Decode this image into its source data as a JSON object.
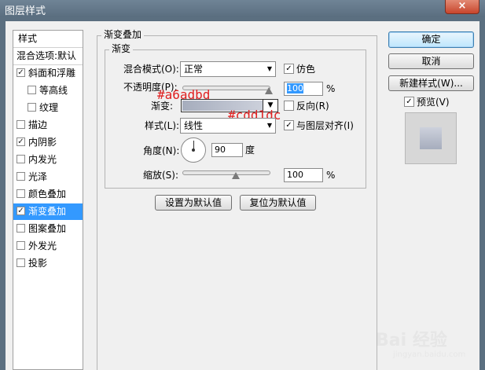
{
  "window": {
    "title": "图层样式",
    "close_label": "×"
  },
  "styles": {
    "header": "样式",
    "blend_options": "混合选项:默认",
    "items": [
      {
        "label": "斜面和浮雕",
        "checked": true,
        "indent": false,
        "selected": false
      },
      {
        "label": "等高线",
        "checked": false,
        "indent": true,
        "selected": false
      },
      {
        "label": "纹理",
        "checked": false,
        "indent": true,
        "selected": false
      },
      {
        "label": "描边",
        "checked": false,
        "indent": false,
        "selected": false
      },
      {
        "label": "内阴影",
        "checked": true,
        "indent": false,
        "selected": false
      },
      {
        "label": "内发光",
        "checked": false,
        "indent": false,
        "selected": false
      },
      {
        "label": "光泽",
        "checked": false,
        "indent": false,
        "selected": false
      },
      {
        "label": "颜色叠加",
        "checked": false,
        "indent": false,
        "selected": false
      },
      {
        "label": "渐变叠加",
        "checked": true,
        "indent": false,
        "selected": true
      },
      {
        "label": "图案叠加",
        "checked": false,
        "indent": false,
        "selected": false
      },
      {
        "label": "外发光",
        "checked": false,
        "indent": false,
        "selected": false
      },
      {
        "label": "投影",
        "checked": false,
        "indent": false,
        "selected": false
      }
    ]
  },
  "panel": {
    "section_title": "渐变叠加",
    "group_title": "渐变",
    "blend_mode_label": "混合模式(O):",
    "blend_mode_value": "正常",
    "dither_label": "仿色",
    "dither_checked": true,
    "opacity_label": "不透明度(P):",
    "opacity_value": "100",
    "opacity_unit": "%",
    "gradient_label": "渐变:",
    "reverse_label": "反向(R)",
    "reverse_checked": false,
    "style_label": "样式(L):",
    "style_value": "线性",
    "align_label": "与图层对齐(I)",
    "align_checked": true,
    "angle_label": "角度(N):",
    "angle_value": "90",
    "angle_unit": "度",
    "scale_label": "缩放(S):",
    "scale_value": "100",
    "scale_unit": "%",
    "set_default_label": "设置为默认值",
    "reset_default_label": "复位为默认值"
  },
  "annotations": {
    "color1": "#a6adbd",
    "color2": "#cdd1dc"
  },
  "gradient_colors": {
    "start": "#a6adbd",
    "end": "#cdd1dc"
  },
  "buttons": {
    "ok": "确定",
    "cancel": "取消",
    "new_style": "新建样式(W)...",
    "preview_label": "预览(V)",
    "preview_checked": true
  },
  "watermark": {
    "text": "Bai 经验",
    "url": "jingyan.baidu.com"
  }
}
